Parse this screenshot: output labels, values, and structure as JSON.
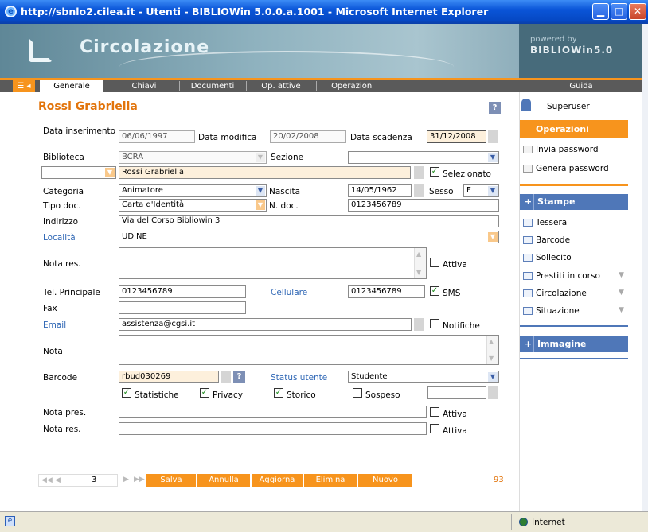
{
  "window": {
    "title": "http://sbnlo2.cilea.it - Utenti - BIBLIOWin 5.0.0.a.1001 - Microsoft Internet Explorer"
  },
  "banner": {
    "app_title": "Circolazione",
    "powered_by": "powered by",
    "product": "BIBLIOWin5.0"
  },
  "menu": {
    "tabs": [
      "Generale",
      "Chiavi",
      "Documenti",
      "Op. attive",
      "Operazioni"
    ],
    "help": "Guida"
  },
  "user": {
    "name": "Rossi Grabriella",
    "help_btn": "?"
  },
  "form": {
    "data_inserimento_label": "Data inserimento",
    "data_inserimento": "06/06/1997",
    "data_modifica_label": "Data modifica",
    "data_modifica": "20/02/2008",
    "data_scadenza_label": "Data scadenza",
    "data_scadenza": "31/12/2008",
    "biblioteca_label": "Biblioteca",
    "biblioteca": "BCRA",
    "sezione_label": "Sezione",
    "sezione": "",
    "nome": "Rossi Grabriella",
    "selezionato_label": "Selezionato",
    "categoria_label": "Categoria",
    "categoria": "Animatore",
    "nascita_label": "Nascita",
    "nascita": "14/05/1962",
    "sesso_label": "Sesso",
    "sesso": "F",
    "tipo_doc_label": "Tipo doc.",
    "tipo_doc": "Carta d'Identità",
    "n_doc_label": "N. doc.",
    "n_doc": "0123456789",
    "indirizzo_label": "Indirizzo",
    "indirizzo": "Via del Corso Bibliowin 3",
    "localita_label": "Località",
    "localita": "UDINE",
    "nota_res_label": "Nota res.",
    "attiva_label": "Attiva",
    "tel_label": "Tel. Principale",
    "tel": "0123456789",
    "cellulare_label": "Cellulare",
    "cellulare": "0123456789",
    "sms_label": "SMS",
    "fax_label": "Fax",
    "fax": "",
    "email_label": "Email",
    "email": "assistenza@cgsi.it",
    "notifiche_label": "Notifiche",
    "nota_label": "Nota",
    "barcode_label": "Barcode",
    "barcode": "rbud030269",
    "barcode_help": "?",
    "status_label": "Status utente",
    "status": "Studente",
    "statistiche_label": "Statistiche",
    "privacy_label": "Privacy",
    "storico_label": "Storico",
    "sospeso_label": "Sospeso",
    "nota_pres_label": "Nota pres.",
    "attiva2_label": "Attiva",
    "nota_res2_label": "Nota res.",
    "attiva3_label": "Attiva"
  },
  "nav": {
    "first": "◀◀",
    "prev": "◀",
    "page": "3",
    "next": "▶",
    "last": "▶▶",
    "count": "93",
    "buttons": [
      "Salva",
      "Annulla",
      "Aggiorna",
      "Elimina",
      "Nuovo"
    ]
  },
  "side": {
    "user": "Superuser",
    "operazioni": "Operazioni",
    "invia_password": "Invia password",
    "genera_password": "Genera password",
    "stampe": "Stampe",
    "stampe_items": [
      "Tessera",
      "Barcode",
      "Sollecito",
      "Prestiti in corso",
      "Circolazione",
      "Situazione"
    ],
    "immagine": "Immagine"
  },
  "status": {
    "zone": "Internet"
  },
  "colors": {
    "accent": "#f7941d",
    "name": "#e2740b",
    "blue": "#4f77b8",
    "titlebar": "#0a55d8"
  }
}
